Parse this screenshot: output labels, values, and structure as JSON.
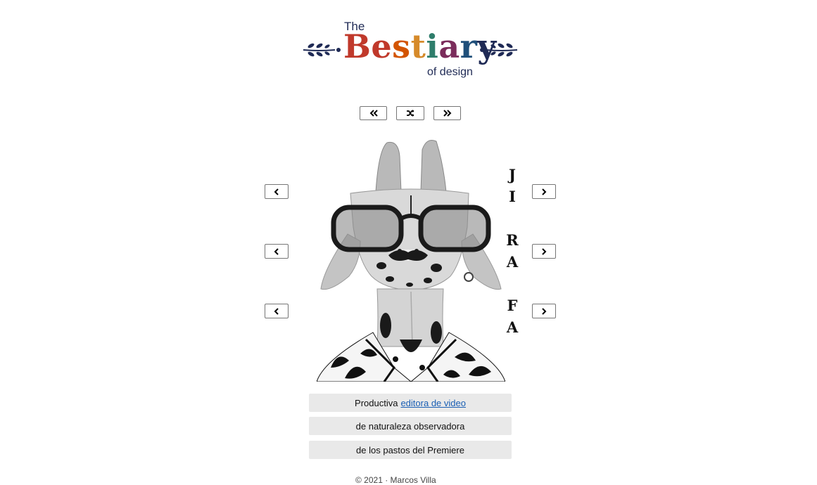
{
  "logo": {
    "the": "The",
    "word": "Bestiary",
    "subtitle": "of design"
  },
  "nav": {
    "prev_icon": "double-chevron-left-icon",
    "shuffle_icon": "shuffle-icon",
    "next_icon": "double-chevron-right-icon"
  },
  "name_letters": [
    "J",
    "I",
    "R",
    "A",
    "F",
    "A"
  ],
  "phrases": {
    "line1_text": "Productiva",
    "line1_link": "editora de video",
    "line2": "de naturaleza observadora",
    "line3": "de los pastos del Premiere"
  },
  "footer": {
    "text": "© 2021 · Marcos Villa"
  },
  "colors": {
    "navy": "#1f2a55",
    "link": "#1a5fb4",
    "phrase_bg": "#e9e9e9"
  }
}
